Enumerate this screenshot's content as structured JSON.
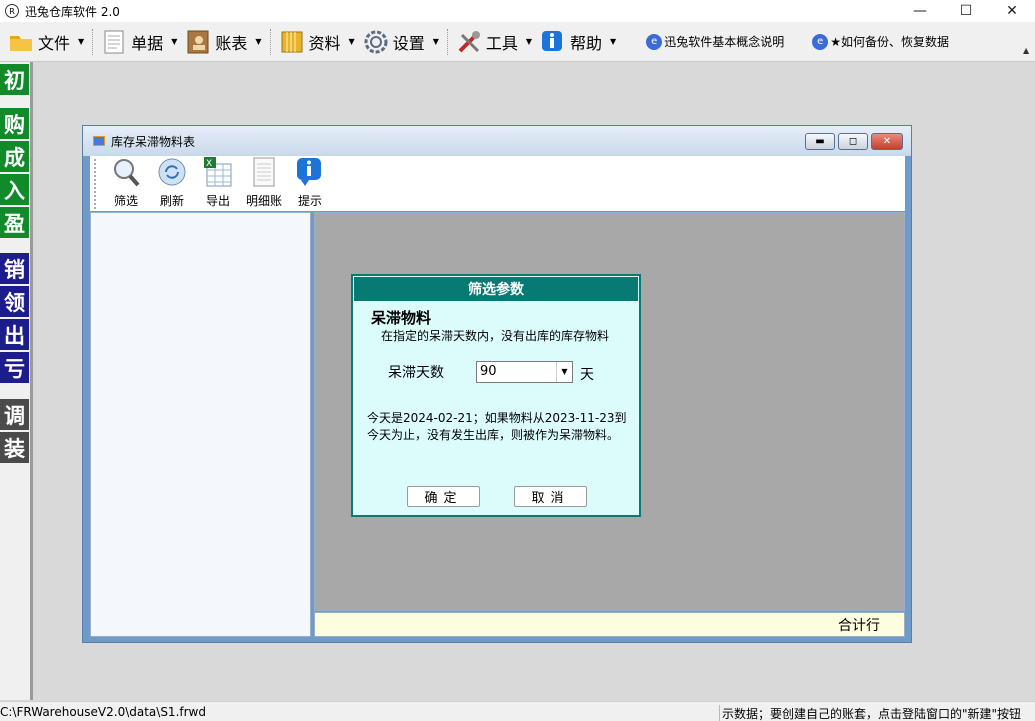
{
  "app": {
    "title": "迅兔仓库软件 2.0",
    "icon_text": "R"
  },
  "window_controls": {
    "minimize": "—",
    "maximize": "☐",
    "close": "✕"
  },
  "menu": {
    "items": [
      {
        "label": "文件",
        "icon": "folder-icon",
        "color": "#e9a51a"
      },
      {
        "label": "单据",
        "icon": "document-icon",
        "color": "#ffffff"
      },
      {
        "label": "账表",
        "icon": "ledger-book-icon",
        "color": "#a9773f"
      },
      {
        "label": "资料",
        "icon": "binder-icon",
        "color": "#e8b32a"
      },
      {
        "label": "设置",
        "icon": "gear-icon",
        "color": "#5a6c82"
      },
      {
        "label": "工具",
        "icon": "tools-icon",
        "color": "#c62828"
      },
      {
        "label": "帮助",
        "icon": "info-icon",
        "color": "#1e73d8"
      }
    ],
    "help_links": [
      "迅兔软件基本概念说明",
      "★如何备份、恢复数据"
    ]
  },
  "sidebar": {
    "groups": [
      {
        "color": "green",
        "items": [
          "初",
          "购",
          "成",
          "入",
          "盈"
        ]
      },
      {
        "color": "navy",
        "items": [
          "销",
          "领",
          "出",
          "亏"
        ]
      },
      {
        "color": "gray",
        "items": [
          "调",
          "装"
        ]
      }
    ]
  },
  "child_window": {
    "title": "库存呆滞物料表",
    "toolbar": [
      {
        "label": "筛选",
        "icon": "magnifier-icon"
      },
      {
        "label": "刷新",
        "icon": "refresh-icon"
      },
      {
        "label": "导出",
        "icon": "excel-export-icon"
      },
      {
        "label": "明细账",
        "icon": "ledger-detail-icon"
      },
      {
        "label": "提示",
        "icon": "info-icon"
      }
    ],
    "total_row_label": "合计行"
  },
  "dialog": {
    "header": "筛选参数",
    "title": "呆滞物料",
    "subtitle": "在指定的呆滞天数内，没有出库的库存物料",
    "days_label": "呆滞天数",
    "days_value": "90",
    "days_unit": "天",
    "note": "今天是2024-02-21；如果物料从2023-11-23到今天为止，没有发生出库，则被作为呆滞物料。",
    "ok_label": "确定",
    "cancel_label": "取消"
  },
  "statusbar": {
    "path": "C:\\FRWarehouseV2.0\\data\\S1.frwd",
    "message": "示数据；要创建自己的账套，点击登陆窗口的\"新建\"按钮"
  },
  "colors": {
    "sidebar_green": "#118a2a",
    "sidebar_navy": "#1c1c8c",
    "sidebar_gray": "#4a4a4a",
    "dialog_header": "#087a74",
    "dialog_bg": "#dcfcfc"
  }
}
